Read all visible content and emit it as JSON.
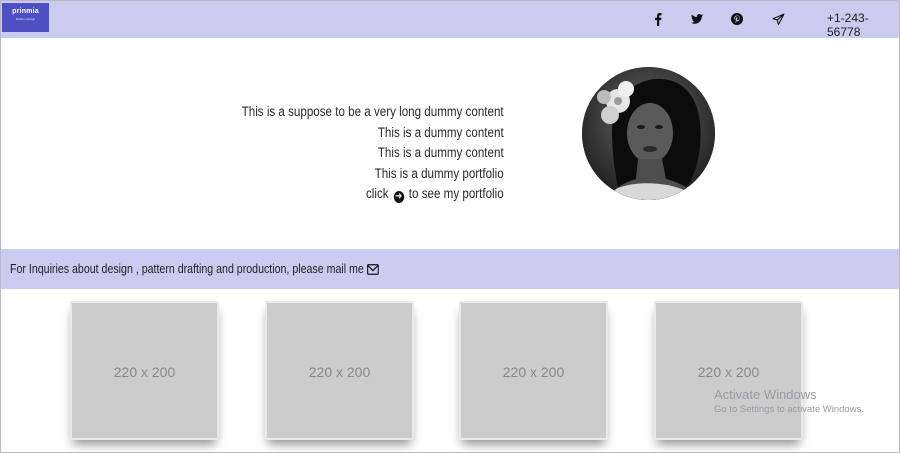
{
  "header": {
    "logo": {
      "name": "prinmia",
      "tagline": "fashion design"
    },
    "social": [
      {
        "icon": "facebook-icon"
      },
      {
        "icon": "twitter-icon"
      },
      {
        "icon": "pinterest-icon"
      },
      {
        "icon": "send-icon"
      }
    ],
    "phone": "+1-243-56778"
  },
  "hero": {
    "lines": [
      "This is a suppose to be a very long dummy content",
      "This is a dummy content",
      "This is a dummy content",
      "This is a dummy portfolio"
    ],
    "cta_before": "click",
    "cta_after": "to see my portfolio",
    "cta_icon": "arrow-circle-right-icon",
    "portrait_icon": "profile-photo"
  },
  "band": {
    "text": "For Inquiries about design , pattern drafting and production, please mail me",
    "icon": "envelope-icon"
  },
  "cards": [
    {
      "label": "220 x 200"
    },
    {
      "label": "220 x 200"
    },
    {
      "label": "220 x 200"
    },
    {
      "label": "220 x 200"
    }
  ],
  "watermark": {
    "title": "Activate Windows",
    "subtitle": "Go to Settings to activate Windows."
  },
  "colors": {
    "header_bg": "#cbcbef",
    "logo_bg": "#4f4fc4",
    "band_bg": "#cbcbef",
    "placeholder_bg": "#cccccc"
  }
}
